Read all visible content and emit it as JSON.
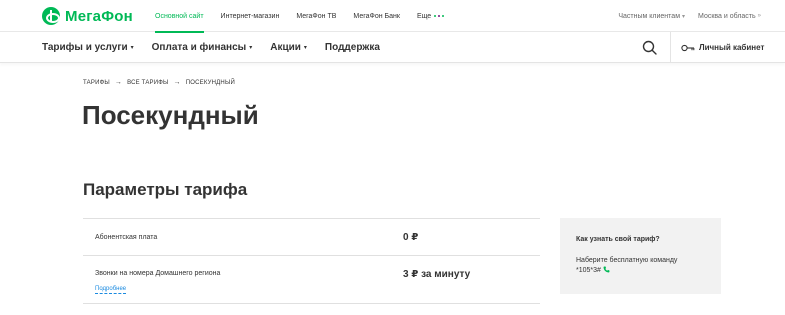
{
  "brand": {
    "name": "МегаФон",
    "color": "#00b956"
  },
  "topnav": {
    "items": [
      {
        "label": "Основной сайт",
        "active": true
      },
      {
        "label": "Интернет-магазин",
        "active": false
      },
      {
        "label": "МегаФон ТВ",
        "active": false
      },
      {
        "label": "МегаФон Банк",
        "active": false
      },
      {
        "label": "Еще",
        "active": false
      }
    ]
  },
  "topright": {
    "segment": "Частным клиентам",
    "region": "Москва и область"
  },
  "mainnav": {
    "items": [
      {
        "label": "Тарифы и услуги",
        "has_dropdown": true
      },
      {
        "label": "Оплата и финансы",
        "has_dropdown": true
      },
      {
        "label": "Акции",
        "has_dropdown": true
      },
      {
        "label": "Поддержка",
        "has_dropdown": false
      }
    ],
    "cabinet_label": "Личный кабинет"
  },
  "breadcrumb": [
    "Тарифы",
    "Все тарифы",
    "Посекундный"
  ],
  "page_title": "Посекундный",
  "params": {
    "title": "Параметры тарифа",
    "rows": [
      {
        "label": "Абонентская плата",
        "value": "0 ₽"
      },
      {
        "label": "Звонки на номера Домашнего региона",
        "value": "3 ₽ за минуту",
        "more_link": "Подробнее"
      }
    ]
  },
  "infobox": {
    "title": "Как узнать свой тариф?",
    "text": "Наберите бесплатную команду",
    "command": "*105*3#"
  }
}
